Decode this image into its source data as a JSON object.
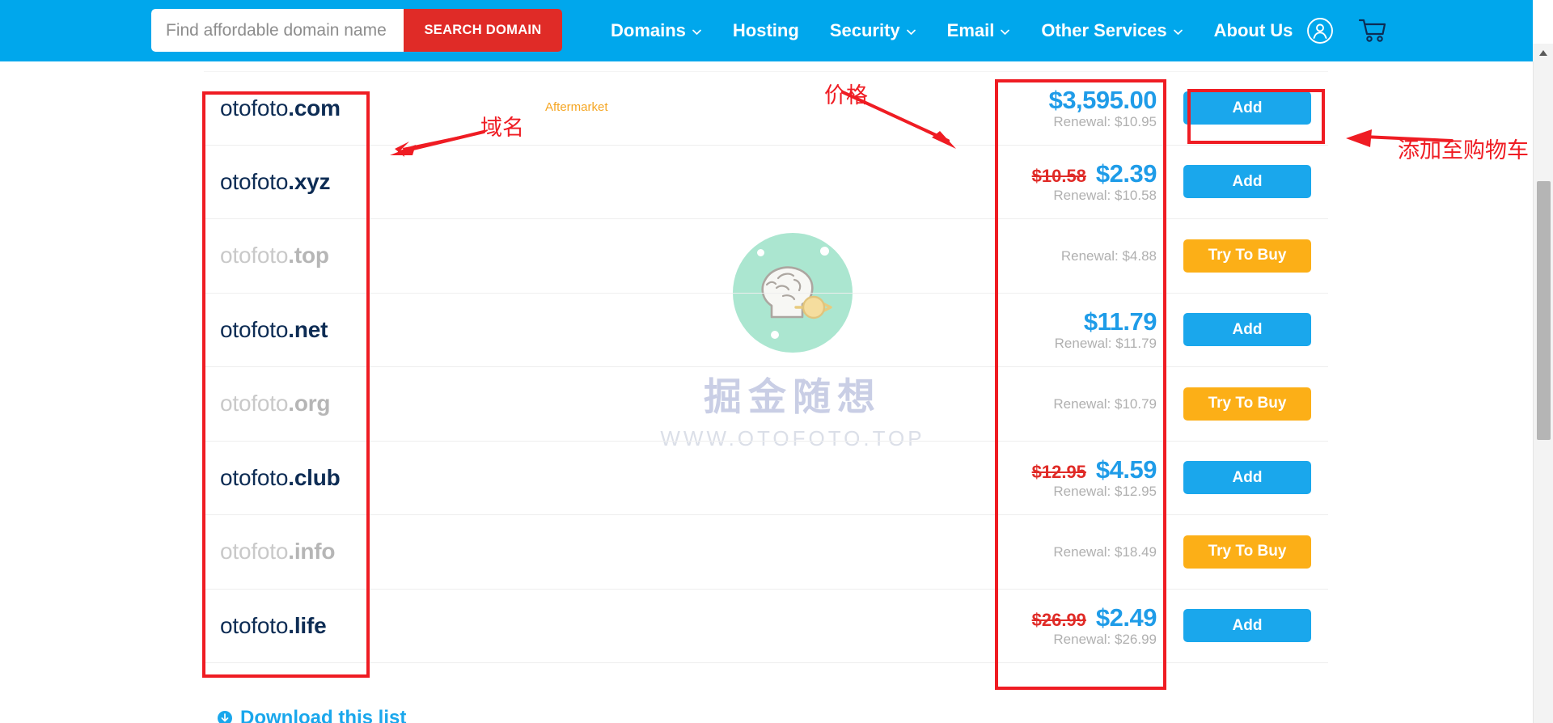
{
  "header": {
    "search": {
      "placeholder": "Find affordable domain name",
      "value": "",
      "button_label": "SEARCH DOMAIN"
    },
    "nav": [
      {
        "label": "Domains",
        "has_caret": true
      },
      {
        "label": "Hosting",
        "has_caret": false
      },
      {
        "label": "Security",
        "has_caret": true
      },
      {
        "label": "Email",
        "has_caret": true
      },
      {
        "label": "Other Services",
        "has_caret": true
      },
      {
        "label": "About Us",
        "has_caret": false
      }
    ],
    "icons": [
      {
        "name": "account-icon"
      },
      {
        "name": "cart-icon"
      }
    ],
    "colors": {
      "bar": "#00a7ec",
      "search_button": "#e02b27"
    }
  },
  "results": [
    {
      "sld": "otofoto",
      "tld": ".com",
      "available": true,
      "badge": "Aftermarket",
      "price_old": "",
      "price_new": "$3,595.00",
      "renewal": "Renewal: $10.95",
      "action": "Add",
      "action_type": "add"
    },
    {
      "sld": "otofoto",
      "tld": ".xyz",
      "available": true,
      "badge": "",
      "price_old": "$10.58",
      "price_new": "$2.39",
      "renewal": "Renewal: $10.58",
      "action": "Add",
      "action_type": "add"
    },
    {
      "sld": "otofoto",
      "tld": ".top",
      "available": false,
      "badge": "",
      "price_old": "",
      "price_new": "",
      "renewal": "Renewal: $4.88",
      "action": "Try To Buy",
      "action_type": "try"
    },
    {
      "sld": "otofoto",
      "tld": ".net",
      "available": true,
      "badge": "",
      "price_old": "",
      "price_new": "$11.79",
      "renewal": "Renewal: $11.79",
      "action": "Add",
      "action_type": "add"
    },
    {
      "sld": "otofoto",
      "tld": ".org",
      "available": false,
      "badge": "",
      "price_old": "",
      "price_new": "",
      "renewal": "Renewal: $10.79",
      "action": "Try To Buy",
      "action_type": "try"
    },
    {
      "sld": "otofoto",
      "tld": ".club",
      "available": true,
      "badge": "",
      "price_old": "$12.95",
      "price_new": "$4.59",
      "renewal": "Renewal: $12.95",
      "action": "Add",
      "action_type": "add"
    },
    {
      "sld": "otofoto",
      "tld": ".info",
      "available": false,
      "badge": "",
      "price_old": "",
      "price_new": "",
      "renewal": "Renewal: $18.49",
      "action": "Try To Buy",
      "action_type": "try"
    },
    {
      "sld": "otofoto",
      "tld": ".life",
      "available": true,
      "badge": "",
      "price_old": "$26.99",
      "price_new": "$2.49",
      "renewal": "Renewal: $26.99",
      "action": "Add",
      "action_type": "add"
    }
  ],
  "watermark": {
    "cn_text": "掘金随想",
    "url_text": "WWW.OTOFOTO.TOP",
    "icon": "brain-head-icon"
  },
  "annotations": [
    {
      "name": "domain-column",
      "text": "域名"
    },
    {
      "name": "price-column",
      "text": "价格"
    },
    {
      "name": "add-to-cart",
      "text": "添加至购物车"
    }
  ],
  "bottom_link": {
    "label": "Download this list"
  },
  "colors": {
    "annotation_red": "#ef1c23",
    "price_blue": "#1f9ce8",
    "price_old_red": "#e02b27",
    "add_button": "#1aa7ec",
    "try_button": "#fcaf17",
    "aftermarket_orange": "#f5a623",
    "domain_navy": "#0d2c54"
  }
}
